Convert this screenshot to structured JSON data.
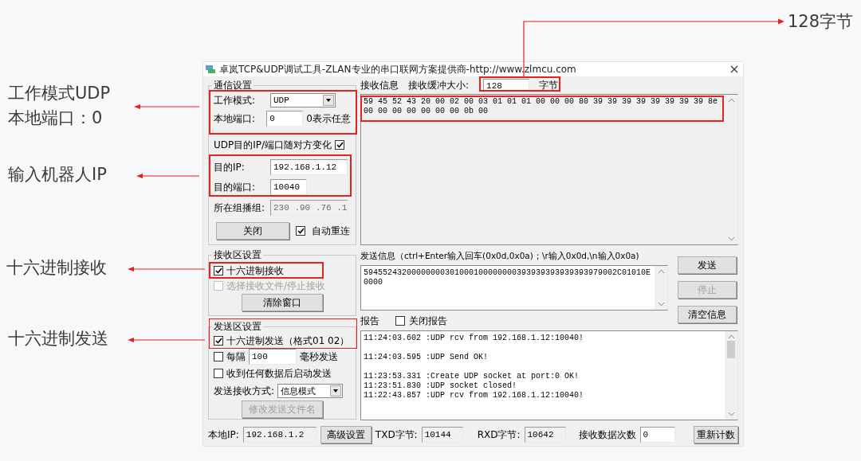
{
  "window": {
    "title": "卓岚TCP&UDP调试工具-ZLAN专业的串口联网方案提供商-http://www.zlmcu.com"
  },
  "comm_settings": {
    "legend": "通信设置",
    "mode": {
      "label": "工作模式:",
      "value": "UDP"
    },
    "local_port": {
      "label": "本地端口:",
      "value": "0",
      "hint": "0表示任意"
    },
    "follow_peer": {
      "label": "UDP目的IP/端口随对方变化",
      "checked": true
    },
    "dest_ip": {
      "label": "目的IP:",
      "value": "192.168.1.12"
    },
    "dest_port": {
      "label": "目的端口:",
      "value": "10040"
    },
    "multicast": {
      "label": "所在组播组:",
      "value": "230 .90 .76 .1",
      "disabled": true
    },
    "close_button": "关闭",
    "auto_reconnect": {
      "label": "自动重连",
      "checked": true
    }
  },
  "receive_settings": {
    "legend": "接收区设置",
    "options": [
      {
        "label": "十六进制接收",
        "checked": true,
        "disabled": false
      },
      {
        "label": "选择接收文件/停止接收",
        "checked": false,
        "disabled": true
      }
    ],
    "clear_button": "清除窗口"
  },
  "send_settings": {
    "legend": "发送区设置",
    "hex_send": {
      "label": "十六进制发送（格式01 02）",
      "checked": true
    },
    "interval": {
      "label": "每隔",
      "value": "100",
      "unit": "毫秒发送",
      "checked": false
    },
    "auto_send": {
      "label": "收到任何数据后启动发送",
      "checked": false
    },
    "mode": {
      "label": "发送接收方式:",
      "value": "信息模式"
    },
    "file_button": {
      "label": "修改发送文件名",
      "disabled": true
    }
  },
  "receive": {
    "title": "接收信息",
    "buffer_label": "接收缓冲大小:",
    "buffer_value": "128",
    "buffer_unit": "字节",
    "lines": [
      "59 45 52 43 20 00 02 00 03 01 01 01 00 00 00 80 39 39 39 39 39 39 39 39 8e",
      "00 00 00 00 00 00 00 0b 00"
    ]
  },
  "send": {
    "title": "发送信息（ctrl+Enter输入回车(0x0d,0x0a)；\\r输入0x0d,\\n输入0x0a)",
    "lines": [
      "59455243200000000301000100000000393939393939393979002C01010E",
      "0000"
    ],
    "buttons": [
      {
        "label": "发送",
        "disabled": false
      },
      {
        "label": "停止",
        "disabled": true
      },
      {
        "label": "清空信息",
        "disabled": false
      }
    ]
  },
  "report": {
    "title": "报告",
    "close_report": {
      "label": "关闭报告",
      "checked": false
    },
    "blocks": [
      [
        "11:24:03.602 :UDP rcv from 192.168.1.12:10040!"
      ],
      [
        "11:24:03.595 :UDP Send OK!"
      ],
      [
        "11:23:53.331 :Create UDP socket at port:0 OK!",
        "11:23:51.830 :UDP socket closed!",
        "11:22:43.857 :UDP rcv from 192.168.1.12:10040!"
      ]
    ]
  },
  "status_bar": {
    "local_ip": {
      "label": "本地IP:",
      "value": "192.168.1.2"
    },
    "advanced_button": "高级设置",
    "txd": {
      "label": "TXD字节:",
      "value": "10144"
    },
    "rxd": {
      "label": "RXD字节:",
      "value": "10642"
    },
    "rx_count": {
      "label": "接收数据次数",
      "value": "0"
    },
    "reset_button": "重新计数"
  },
  "annotations": [
    {
      "lines": [
        "工作模式UDP",
        "本地端口：0"
      ]
    },
    {
      "lines": [
        "输入机器人IP"
      ]
    },
    {
      "lines": [
        "十六进制接收"
      ]
    },
    {
      "lines": [
        "十六进制发送"
      ]
    },
    {
      "lines": [
        "128字节"
      ]
    }
  ]
}
